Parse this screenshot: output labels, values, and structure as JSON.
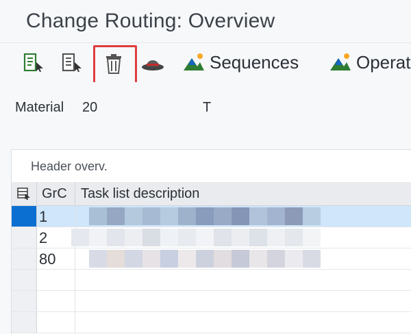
{
  "window": {
    "title": "Change Routing: Overview"
  },
  "toolbar": {
    "sequences_label": "Sequences",
    "operations_label": "Operat"
  },
  "header_fields": {
    "material_label": "Material",
    "material_value_prefix": "20",
    "text_value_prefix": "T"
  },
  "header_overview": {
    "title": "Header overv.",
    "columns": {
      "grc": "GrC",
      "description": "Task list description"
    },
    "rows": [
      {
        "grc": "1",
        "selected": true
      },
      {
        "grc": "2",
        "selected": false
      },
      {
        "grc": "80",
        "selected": false
      }
    ]
  },
  "colors": {
    "highlight": "#e03c3c",
    "selection": "#0a6fd1"
  }
}
